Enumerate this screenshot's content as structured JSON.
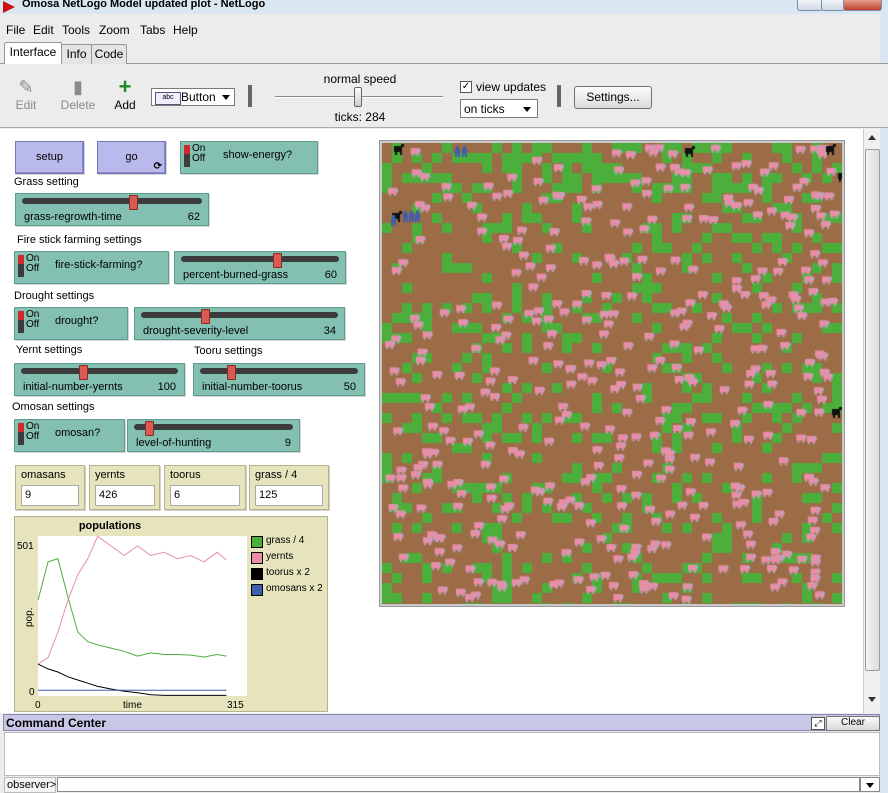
{
  "window": {
    "title": "Omosa NetLogo Model updated plot - NetLogo"
  },
  "menu": [
    "File",
    "Edit",
    "Tools",
    "Zoom",
    "Tabs",
    "Help"
  ],
  "tabs": [
    "Interface",
    "Info",
    "Code"
  ],
  "toolbar": {
    "edit": "Edit",
    "delete": "Delete",
    "add": "Add",
    "widget_type": "Button",
    "speed_label": "normal speed",
    "ticks": "ticks: 284",
    "view_updates": "view updates",
    "update_mode": "on ticks",
    "settings": "Settings..."
  },
  "widgets": {
    "setup": "setup",
    "go": "go",
    "switch_on": "On",
    "switch_off": "Off",
    "show_energy": "show-energy?",
    "grass_note": "Grass setting",
    "grass_regrowth": {
      "label": "grass-regrowth-time",
      "value": "62"
    },
    "fire_note": "Fire stick farming settings",
    "fire_stick": "fire-stick-farming?",
    "percent_burned": {
      "label": "percent-burned-grass",
      "value": "60"
    },
    "drought_note": "Drought settings",
    "drought": "drought?",
    "drought_severity": {
      "label": "drought-severity-level",
      "value": "34"
    },
    "yernt_note": "Yernt settings",
    "tooru_note": "Tooru settings",
    "init_yernts": {
      "label": "initial-number-yernts",
      "value": "100"
    },
    "init_toorus": {
      "label": "initial-number-toorus",
      "value": "50"
    },
    "omosan_note": "Omosan settings",
    "omosan": "omosan?",
    "hunting": {
      "label": "level-of-hunting",
      "value": "9"
    },
    "monitors": [
      {
        "label": "omasans",
        "value": "9"
      },
      {
        "label": "yernts",
        "value": "426"
      },
      {
        "label": "toorus",
        "value": "6"
      },
      {
        "label": "grass / 4",
        "value": "125"
      }
    ]
  },
  "plot": {
    "title": "populations",
    "ymax": "501",
    "ymin": "0",
    "xmin": "0",
    "xmax": "315",
    "xlabel": "time",
    "ylabel": "pop.",
    "legend": [
      {
        "name": "grass / 4",
        "color": "#4caf3c"
      },
      {
        "name": "yernts",
        "color": "#e98ea6"
      },
      {
        "name": "toorus x 2",
        "color": "#000000"
      },
      {
        "name": "omosans x 2",
        "color": "#3c5eac"
      }
    ]
  },
  "chart_data": {
    "type": "line",
    "title": "populations",
    "xlabel": "time",
    "ylabel": "pop.",
    "xlim": [
      0,
      315
    ],
    "ylim": [
      0,
      501
    ],
    "x": [
      0,
      15,
      30,
      45,
      60,
      75,
      90,
      110,
      130,
      150,
      170,
      190,
      210,
      230,
      250,
      270,
      284
    ],
    "series": [
      {
        "name": "grass / 4",
        "values": [
          300,
          420,
          430,
          310,
          200,
          170,
          160,
          150,
          140,
          125,
          135,
          130,
          130,
          128,
          122,
          130,
          125
        ]
      },
      {
        "name": "yernts",
        "values": [
          100,
          120,
          200,
          300,
          380,
          430,
          500,
          470,
          440,
          470,
          440,
          450,
          430,
          440,
          420,
          450,
          426
        ]
      },
      {
        "name": "toorus x 2",
        "values": [
          100,
          85,
          75,
          60,
          50,
          40,
          30,
          22,
          15,
          10,
          4,
          2,
          2,
          2,
          2,
          2,
          2
        ]
      },
      {
        "name": "omosans x 2",
        "values": [
          18,
          18,
          18,
          18,
          18,
          18,
          18,
          18,
          18,
          18,
          18,
          18,
          18,
          18,
          18,
          18,
          18
        ]
      }
    ]
  },
  "command_center": {
    "title": "Command Center",
    "clear": "Clear",
    "agent": "observer>"
  },
  "colors": {
    "ground": "#9c6c46",
    "grass": "#4caf3c",
    "yernt": "#e98ea6"
  }
}
